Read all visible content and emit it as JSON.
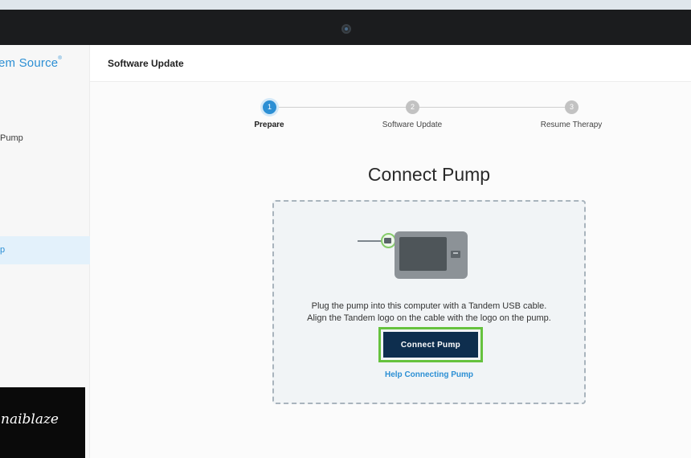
{
  "sidebar": {
    "brand": "em Source",
    "brand_mark": "®",
    "items": [
      {
        "label": "Pump"
      },
      {
        "label": "p"
      }
    ]
  },
  "header": {
    "title": "Software Update"
  },
  "stepper": {
    "steps": [
      {
        "number": "1",
        "label": "Prepare",
        "state": "active"
      },
      {
        "number": "2",
        "label": "Software Update",
        "state": "pending"
      },
      {
        "number": "3",
        "label": "Resume Therapy",
        "state": "pending"
      }
    ]
  },
  "content": {
    "title": "Connect Pump",
    "instruction_line1": "Plug the pump into this computer with a Tandem USB cable.",
    "instruction_line2": "Align the Tandem logo on the cable with the logo on the pump.",
    "connect_button": "Connect Pump",
    "help_link": "Help Connecting Pump"
  },
  "watermark": {
    "text": "naiblaze"
  },
  "colors": {
    "accent_blue": "#2c8fd4",
    "button_navy": "#0e2e4e",
    "highlight_green": "#66c23e"
  }
}
